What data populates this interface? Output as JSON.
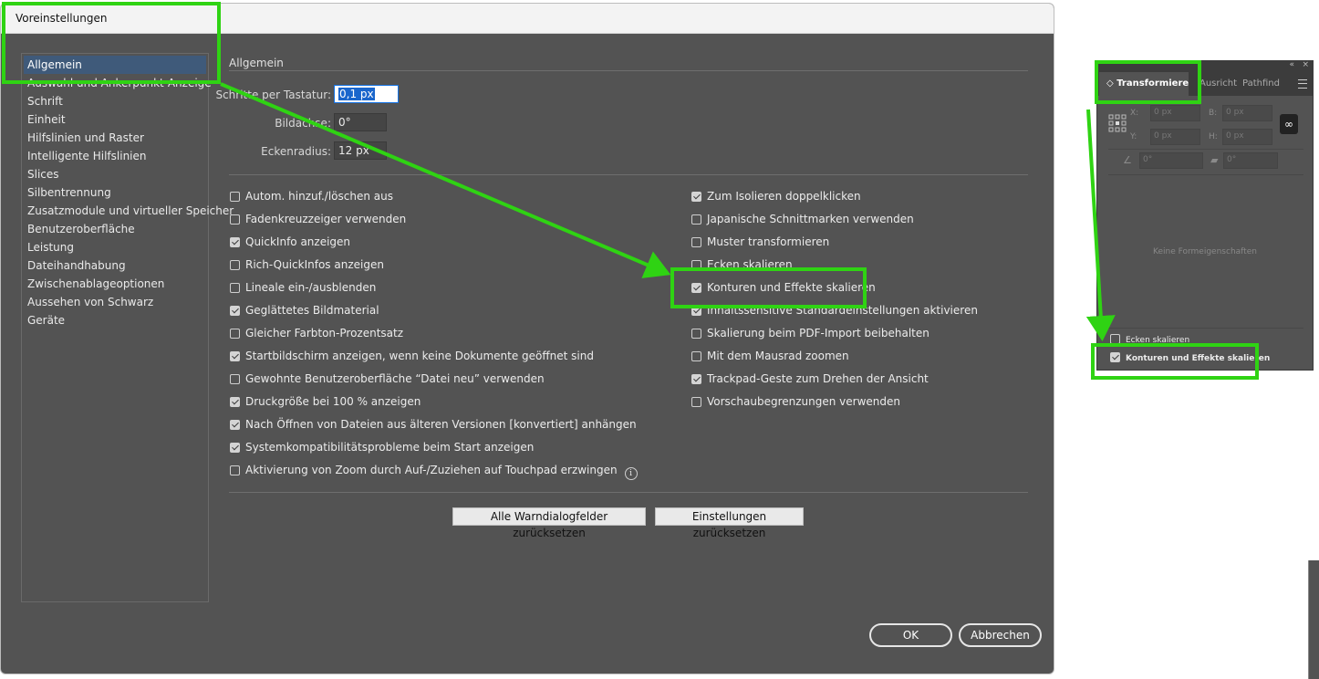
{
  "dialog": {
    "title": "Voreinstellungen",
    "sidebar_items": [
      "Allgemein",
      "Auswahl und Ankerpunkt-Anzeige",
      "Schrift",
      "Einheit",
      "Hilfslinien und Raster",
      "Intelligente Hilfslinien",
      "Slices",
      "Silbentrennung",
      "Zusatzmodule und virtueller Speicher",
      "Benutzeroberfläche",
      "Leistung",
      "Dateihandhabung",
      "Zwischenablageoptionen",
      "Aussehen von Schwarz",
      "Geräte"
    ],
    "section_title": "Allgemein",
    "fields": {
      "keyboard_increment_label": "Schritte per Tastatur:",
      "keyboard_increment_value": "0,1 px",
      "constrain_angle_label": "Bildachse:",
      "constrain_angle_value": "0°",
      "corner_radius_label": "Eckenradius:",
      "corner_radius_value": "12 px"
    },
    "left_checkboxes": [
      {
        "label": "Autom. hinzuf./löschen aus",
        "checked": false
      },
      {
        "label": "Fadenkreuzzeiger verwenden",
        "checked": false
      },
      {
        "label": "QuickInfo anzeigen",
        "checked": true
      },
      {
        "label": "Rich-QuickInfos anzeigen",
        "checked": false
      },
      {
        "label": "Lineale ein-/ausblenden",
        "checked": false
      },
      {
        "label": "Geglättetes Bildmaterial",
        "checked": true
      },
      {
        "label": "Gleicher Farbton-Prozentsatz",
        "checked": false
      },
      {
        "label": "Startbildschirm anzeigen, wenn keine Dokumente geöffnet sind",
        "checked": true
      },
      {
        "label": "Gewohnte Benutzeroberfläche “Datei neu” verwenden",
        "checked": false
      },
      {
        "label": "Druckgröße bei 100 % anzeigen",
        "checked": true
      },
      {
        "label": "Nach Öffnen von Dateien aus älteren Versionen [konvertiert] anhängen",
        "checked": true
      },
      {
        "label": "Systemkompatibilitätsprobleme beim Start anzeigen",
        "checked": true
      },
      {
        "label": "Aktivierung von Zoom durch Auf-/Zuziehen auf Touchpad erzwingen",
        "checked": false
      }
    ],
    "right_checkboxes": [
      {
        "label": "Zum Isolieren doppelklicken",
        "checked": true
      },
      {
        "label": "Japanische Schnittmarken verwenden",
        "checked": false
      },
      {
        "label": "Muster transformieren",
        "checked": false
      },
      {
        "label": "Ecken skalieren",
        "checked": false
      },
      {
        "label": "Konturen und Effekte skalieren",
        "checked": true
      },
      {
        "label": "Inhaltssensitive Standardeinstellungen aktivieren",
        "checked": true
      },
      {
        "label": "Skalierung beim PDF-Import beibehalten",
        "checked": false
      },
      {
        "label": "Mit dem Mausrad zoomen",
        "checked": false
      },
      {
        "label": "Trackpad-Geste zum Drehen der Ansicht",
        "checked": true
      },
      {
        "label": "Vorschaubegrenzungen verwenden",
        "checked": false
      }
    ],
    "buttons": {
      "reset_warnings": "Alle Warndialogfelder zurücksetzen",
      "reset_prefs": "Einstellungen zurücksetzen",
      "ok": "OK",
      "cancel": "Abbrechen"
    }
  },
  "panel": {
    "tabs": [
      "Transformieren",
      "Ausricht",
      "Pathfind"
    ],
    "tab_arrow": "◇",
    "x_label": "X:",
    "x_value": "0 px",
    "y_label": "Y:",
    "y_value": "0 px",
    "w_label": "B:",
    "w_value": "0 px",
    "h_label": "H:",
    "h_value": "0 px",
    "angle_value": "0°",
    "shear_value": "0°",
    "empty_message": "Keine Formeigenschaften",
    "checkboxes": [
      {
        "label": "Ecken skalieren",
        "checked": false
      },
      {
        "label": "Konturen und Effekte skalieren",
        "checked": true
      }
    ]
  },
  "colors": {
    "highlight": "#2fd313",
    "dialog_bg": "#535353",
    "selection": "#3f5a7a"
  }
}
